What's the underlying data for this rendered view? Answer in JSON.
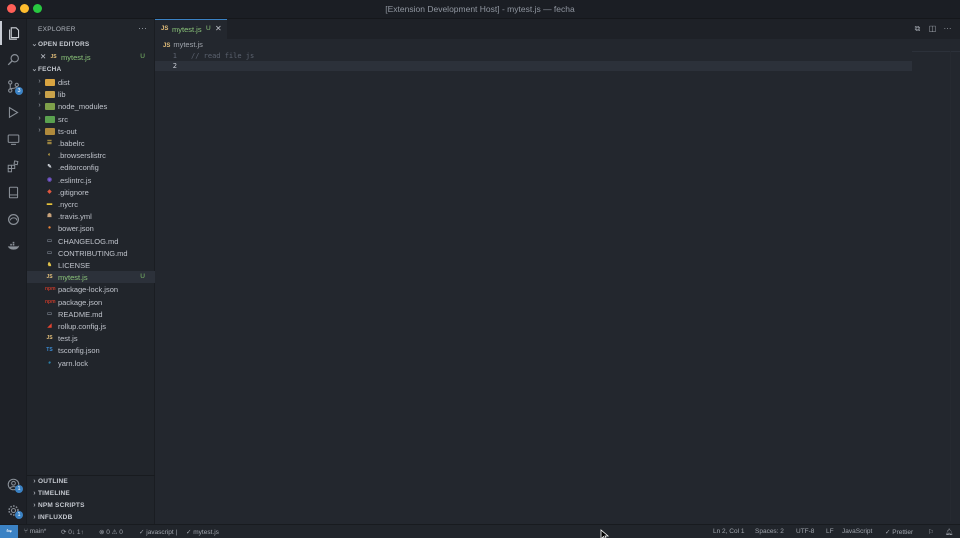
{
  "window": {
    "title": "[Extension Development Host] - mytest.js — fecha"
  },
  "activity_bar": {
    "badges": {
      "source_control": "3",
      "accounts": "1",
      "settings": "1"
    }
  },
  "sidebar": {
    "title": "EXPLORER",
    "more": "···",
    "open_editors": {
      "header": "OPEN EDITORS",
      "items": [
        {
          "close": "✕",
          "icon": "JS",
          "name": "mytest.js",
          "status": "U"
        }
      ]
    },
    "project": {
      "header": "FECHA",
      "folders": [
        {
          "name": "dist",
          "color": "#d9a441"
        },
        {
          "name": "lib",
          "color": "#c9a24a"
        },
        {
          "name": "node_modules",
          "color": "#7ea04a"
        },
        {
          "name": "src",
          "color": "#5aa14f"
        },
        {
          "name": "ts-out",
          "color": "#b08a3c"
        }
      ],
      "files": [
        {
          "name": ".babelrc",
          "icon": "☰",
          "color": "#e0b94b"
        },
        {
          "name": ".browserslistrc",
          "icon": "◐",
          "color": "#f2c94c"
        },
        {
          "name": ".editorconfig",
          "icon": "✎",
          "color": "#d0d4da"
        },
        {
          "name": ".eslintrc.js",
          "icon": "◉",
          "color": "#7a5ad6"
        },
        {
          "name": ".gitignore",
          "icon": "◆",
          "color": "#e0573f"
        },
        {
          "name": ".nycrc",
          "icon": "▬",
          "color": "#e8c33a"
        },
        {
          "name": ".travis.yml",
          "icon": "☗",
          "color": "#c8a27a"
        },
        {
          "name": "bower.json",
          "icon": "●",
          "color": "#e8833a"
        },
        {
          "name": "CHANGELOG.md",
          "icon": "▭",
          "color": "#7d8590"
        },
        {
          "name": "CONTRIBUTING.md",
          "icon": "▭",
          "color": "#7d8590"
        },
        {
          "name": "LICENSE",
          "icon": "♞",
          "color": "#e0c24a"
        },
        {
          "name": "mytest.js",
          "icon": "JS",
          "color": "#e5c07b",
          "status": "U"
        },
        {
          "name": "package-lock.json",
          "icon": "npm",
          "color": "#c0392b"
        },
        {
          "name": "package.json",
          "icon": "npm",
          "color": "#c0392b"
        },
        {
          "name": "README.md",
          "icon": "▭",
          "color": "#7d8590"
        },
        {
          "name": "rollup.config.js",
          "icon": "◢",
          "color": "#e4432f"
        },
        {
          "name": "test.js",
          "icon": "JS",
          "color": "#e5c07b"
        },
        {
          "name": "tsconfig.json",
          "icon": "TS",
          "color": "#3a8cd6"
        },
        {
          "name": "yarn.lock",
          "icon": "◕",
          "color": "#2c8ebb"
        }
      ]
    },
    "bottom_sections": [
      "OUTLINE",
      "TIMELINE",
      "NPM SCRIPTS",
      "INFLUXDB"
    ]
  },
  "editor": {
    "tab": {
      "icon": "JS",
      "name": "mytest.js",
      "status": "U",
      "close": "✕"
    },
    "breadcrumb": {
      "icon": "JS",
      "file": "mytest.js"
    },
    "lines": [
      {
        "number": "1",
        "text": "// read file js"
      },
      {
        "number": "2",
        "text": ""
      }
    ]
  },
  "statusbar": {
    "remote": "⇋",
    "branch": "main*",
    "sync": "0↓ 1↑",
    "problems": "⊗ 0 ⚠ 0",
    "js_check": "✓ javascript |",
    "file_check": "✓ mytest.js",
    "position": "Ln 2, Col 1",
    "spaces": "Spaces: 2",
    "encoding": "UTF-8",
    "eol": "LF",
    "language": "JavaScript",
    "prettier": "✓ Prettier"
  }
}
